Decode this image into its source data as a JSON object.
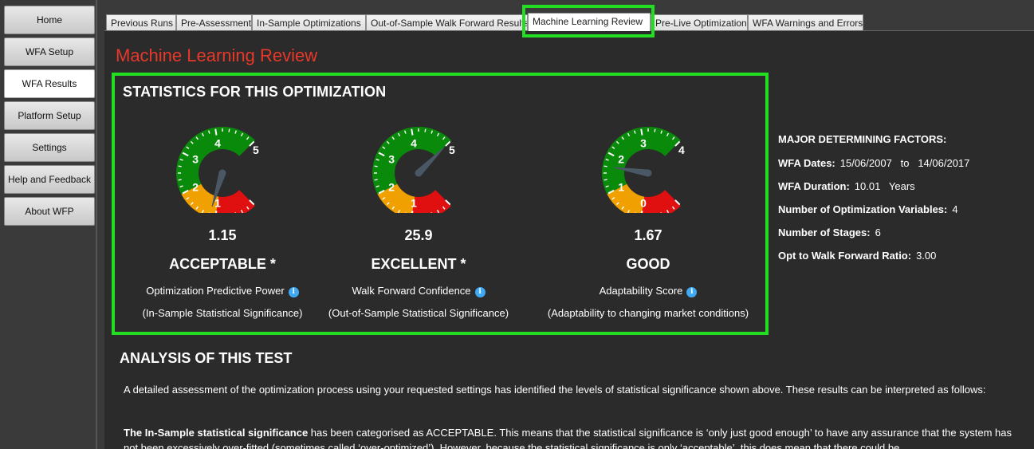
{
  "sidebar": {
    "items": [
      {
        "label": "Home",
        "active": false
      },
      {
        "label": "WFA Setup",
        "active": false
      },
      {
        "label": "WFA Results",
        "active": true
      },
      {
        "label": "Platform Setup",
        "active": false
      },
      {
        "label": "Settings",
        "active": false
      },
      {
        "label": "Help and Feedback",
        "active": false
      },
      {
        "label": "About WFP",
        "active": false
      }
    ]
  },
  "tabs": [
    {
      "label": "Previous Runs",
      "active": false
    },
    {
      "label": "Pre-Assessment",
      "active": false
    },
    {
      "label": "In-Sample Optimizations",
      "active": false
    },
    {
      "label": "Out-of-Sample Walk Forward Results",
      "active": false
    },
    {
      "label": "Machine Learning Review",
      "active": true
    },
    {
      "label": "Pre-Live Optimization",
      "active": false
    },
    {
      "label": "WFA Warnings and Errors",
      "active": false
    }
  ],
  "page_title": "Machine Learning Review",
  "stats": {
    "heading": "STATISTICS FOR THIS OPTIMIZATION",
    "gauges": [
      {
        "min_label": "0",
        "max_label": "5",
        "ticks": [
          "1",
          "2",
          "3",
          "4"
        ],
        "min": 0,
        "max": 5,
        "value": 1.15,
        "value_text": "1.15",
        "rating": "ACCEPTABLE  *",
        "label": "Optimization Predictive Power",
        "sub": "(In-Sample Statistical Significance)",
        "bands": [
          [
            "#e01010",
            0,
            1
          ],
          [
            "#f0a000",
            1,
            2
          ],
          [
            "#0a8a0a",
            2,
            5
          ]
        ]
      },
      {
        "min_label": "0",
        "max_label": "5",
        "ticks": [
          "1",
          "2",
          "3",
          "4"
        ],
        "min": 0,
        "max": 5,
        "value": 5.0,
        "value_text": "25.9",
        "rating": "EXCELLENT  *",
        "label": "Walk Forward Confidence",
        "sub": "(Out-of-Sample Statistical Significance)",
        "bands": [
          [
            "#e01010",
            0,
            1
          ],
          [
            "#f0a000",
            1,
            2
          ],
          [
            "#0a8a0a",
            2,
            5
          ]
        ]
      },
      {
        "min_label": "-1",
        "max_label": "4",
        "ticks": [
          "0",
          "1",
          "2",
          "3"
        ],
        "min": -1,
        "max": 4,
        "value": 1.67,
        "value_text": "1.67",
        "rating": "GOOD",
        "label": "Adaptability Score",
        "sub": "(Adaptability to changing market conditions)",
        "bands": [
          [
            "#e01010",
            -1,
            0
          ],
          [
            "#f0a000",
            0,
            1
          ],
          [
            "#0a8a0a",
            1,
            4
          ]
        ]
      }
    ]
  },
  "factors": {
    "title": "MAJOR DETERMINING FACTORS:",
    "rows": [
      {
        "label": "WFA Dates:",
        "value": "15/06/2007   to   14/06/2017"
      },
      {
        "label": "WFA Duration:",
        "value": "10.01   Years"
      },
      {
        "label": "Number of Optimization Variables:",
        "value": "4"
      },
      {
        "label": "Number of Stages:",
        "value": "6"
      },
      {
        "label": "Opt to Walk Forward Ratio:",
        "value": "3.00"
      }
    ]
  },
  "analysis": {
    "heading": "ANALYSIS OF THIS TEST",
    "p1": "A detailed assessment of the optimization process using your requested settings has identified the levels of statistical significance shown above. These results can be interpreted as follows:",
    "p2_bold": "The In-Sample statistical significance",
    "p2_rest": " has been categorised as ACCEPTABLE. This means that the statistical significance is ‘only just good enough’ to have any assurance that the system has not been excessively over-fitted (sometimes called ‘over-optimized’). However, because the statistical significance is only ‘acceptable’, this does mean that there could be"
  },
  "icons": {
    "info": "info-icon"
  },
  "colors": {
    "accent": "#22dd22",
    "title": "#e8382a",
    "info": "#3fa9f5"
  }
}
